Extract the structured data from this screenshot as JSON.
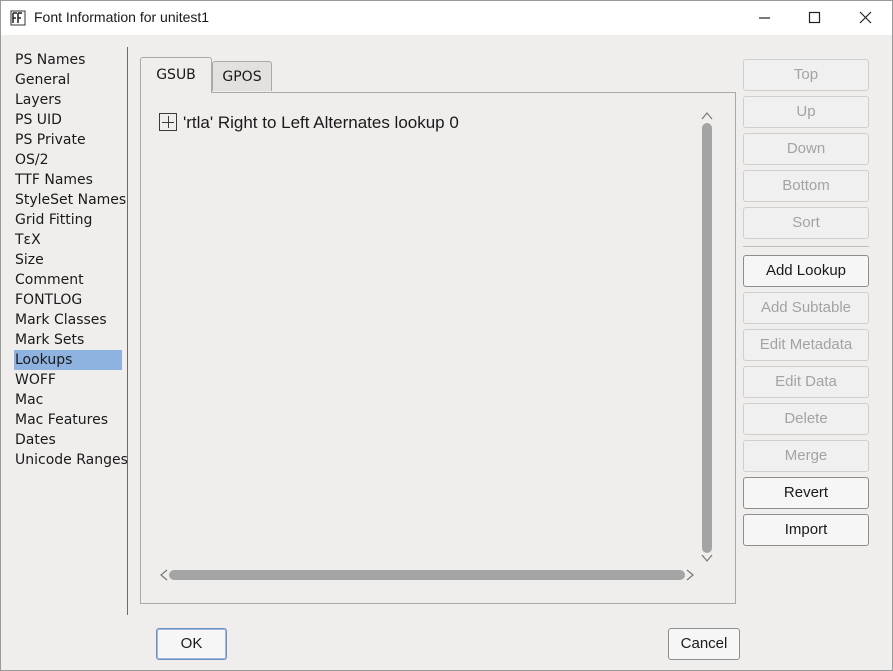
{
  "window": {
    "title": "Font Information for unitest1"
  },
  "sidebar": {
    "items": [
      {
        "label": "PS Names"
      },
      {
        "label": "General"
      },
      {
        "label": "Layers"
      },
      {
        "label": "PS UID"
      },
      {
        "label": "PS Private"
      },
      {
        "label": "OS/2"
      },
      {
        "label": "TTF Names"
      },
      {
        "label": "StyleSet Names"
      },
      {
        "label": "Grid Fitting"
      },
      {
        "label": "TεX"
      },
      {
        "label": "Size"
      },
      {
        "label": "Comment"
      },
      {
        "label": "FONTLOG"
      },
      {
        "label": "Mark Classes"
      },
      {
        "label": "Mark Sets"
      },
      {
        "label": "Lookups"
      },
      {
        "label": "WOFF"
      },
      {
        "label": "Mac"
      },
      {
        "label": "Mac Features"
      },
      {
        "label": "Dates"
      },
      {
        "label": "Unicode Ranges"
      }
    ],
    "selected": "Lookups"
  },
  "tabs": {
    "gsub": "GSUB",
    "gpos": "GPOS",
    "active": "GSUB"
  },
  "lookups": {
    "items": [
      {
        "label": "'rtla' Right to Left Alternates lookup 0"
      }
    ]
  },
  "buttons": {
    "top": "Top",
    "up": "Up",
    "down": "Down",
    "bottom": "Bottom",
    "sort": "Sort",
    "add_lookup": "Add Lookup",
    "add_subtable": "Add Subtable",
    "edit_metadata": "Edit Metadata",
    "edit_data": "Edit Data",
    "delete": "Delete",
    "merge": "Merge",
    "revert": "Revert",
    "import": "Import",
    "ok": "OK",
    "cancel": "Cancel"
  },
  "colors": {
    "selection": "#8fb3e0",
    "disabled_text": "#a3a3a3"
  }
}
